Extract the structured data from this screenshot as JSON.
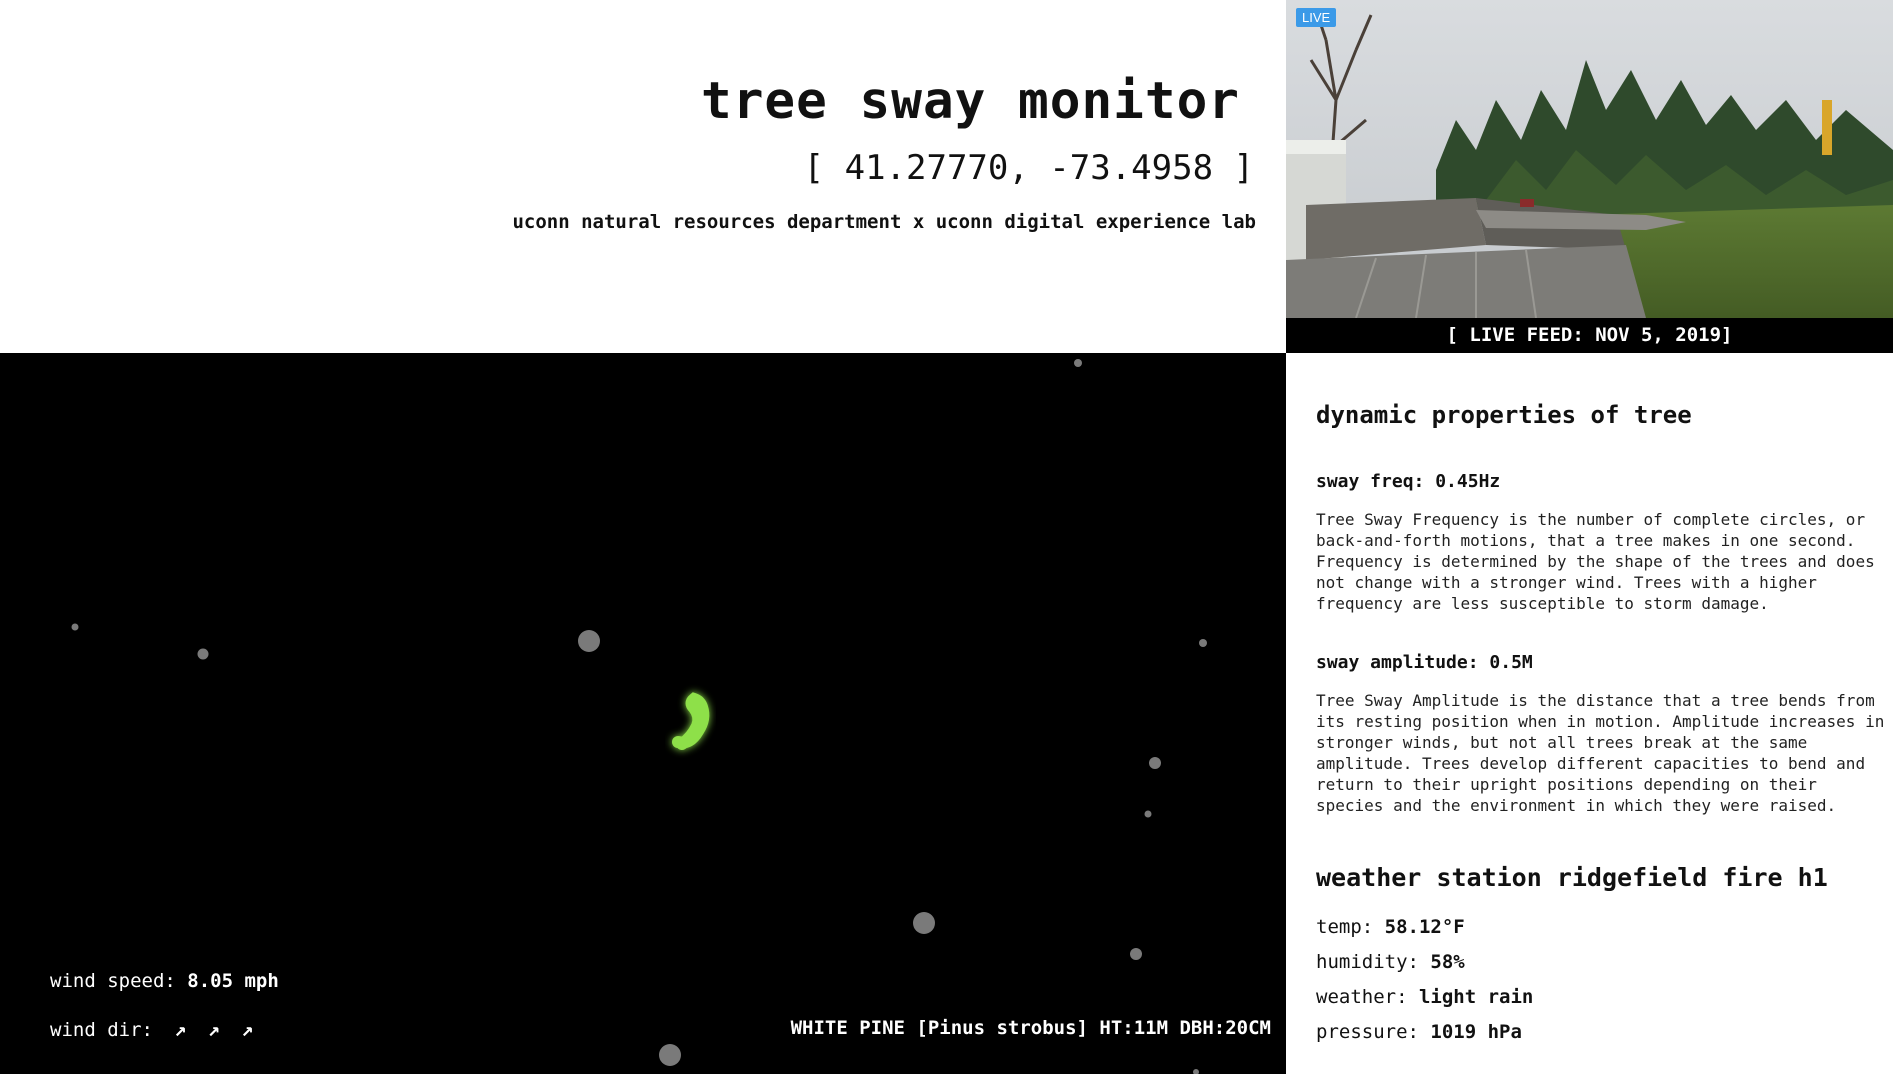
{
  "header": {
    "title": "tree sway monitor",
    "coordinates": "[ 41.27770, -73.4958 ]",
    "subtitle": "uconn natural resources department x uconn digital experience lab"
  },
  "live_feed": {
    "badge": "LIVE",
    "caption": "[ LIVE FEED: NOV 5, 2019]"
  },
  "sway": {
    "wind_speed_label": "wind speed:",
    "wind_speed_value": "8.05 mph",
    "wind_dir_label": "wind dir:",
    "wind_dir_arrows": [
      "↗",
      "↗",
      "↗"
    ],
    "tree_info": "WHITE PINE [Pinus strobus] HT:11M DBH:20CM",
    "trace_color": "#8ee04a"
  },
  "dynamic_properties": {
    "heading": "dynamic properties of tree",
    "frequency": {
      "label": "sway freq:",
      "value": "0.45Hz",
      "description": "Tree Sway Frequency is the number of complete circles, or back-and-forth motions, that a tree makes in one second. Frequency is determined by the shape of the trees and does not change with a stronger wind. Trees with a higher frequency are less susceptible to storm damage."
    },
    "amplitude": {
      "label": "sway amplitude:",
      "value": "0.5M",
      "description": "Tree Sway Amplitude is the distance that a tree bends from its resting position when in motion. Amplitude increases in stronger winds, but not all trees break at the same amplitude. Trees develop different capacities to bend and return to their upright positions depending on their species and the environment in which they were raised."
    }
  },
  "weather_station": {
    "heading": "weather station ridgefield fire h1",
    "temp_label": "temp:",
    "temp_value": "58.12°F",
    "humidity_label": "humidity:",
    "humidity_value": "58%",
    "weather_label": "weather:",
    "weather_value": "light rain",
    "pressure_label": "pressure:",
    "pressure_value": "1019 hPa"
  }
}
